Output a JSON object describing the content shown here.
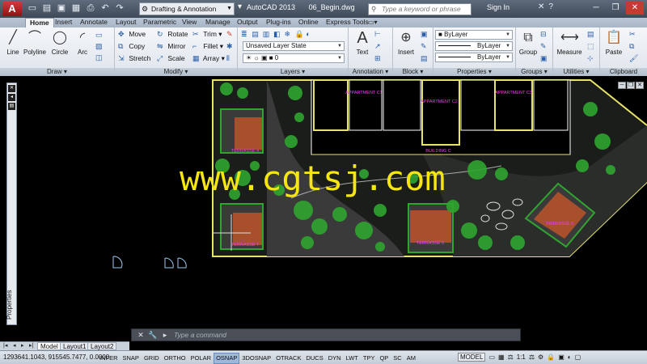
{
  "titlebar": {
    "app_name": "AutoCAD 2013",
    "file_name": "06_Begin.dwg",
    "workspace": "Drafting & Annotation",
    "search_placeholder": "Type a keyword or phrase",
    "sign_in": "Sign In"
  },
  "ribbon_tabs": [
    "Home",
    "Insert",
    "Annotate",
    "Layout",
    "Parametric",
    "View",
    "Manage",
    "Output",
    "Plug-ins",
    "Online",
    "Express Tools"
  ],
  "panels": {
    "draw": {
      "title": "Draw",
      "tools": [
        "Line",
        "Polyline",
        "Circle",
        "Arc"
      ]
    },
    "modify": {
      "title": "Modify",
      "tools": [
        "Move",
        "Rotate",
        "Trim",
        "Copy",
        "Mirror",
        "Fillet",
        "Stretch",
        "Scale",
        "Array"
      ]
    },
    "layers": {
      "title": "Layers",
      "layer_state": "Unsaved Layer State",
      "current_layer": "0"
    },
    "annotation": {
      "title": "Annotation",
      "text_label": "Text"
    },
    "block": {
      "title": "Block",
      "insert_label": "Insert"
    },
    "properties": {
      "title": "Properties",
      "color": "ByLayer",
      "linetype": "ByLayer",
      "lineweight": "ByLayer"
    },
    "groups": {
      "title": "Groups",
      "group_label": "Group"
    },
    "utilities": {
      "title": "Utilities",
      "measure_label": "Measure"
    },
    "clipboard": {
      "title": "Clipboard",
      "paste_label": "Paste"
    }
  },
  "palette_label": "Properties",
  "drawing_labels": {
    "apartment_c1": "APPARTMENT C1",
    "apartment_c2": "APPARTMENT C2",
    "apartment_c3": "APPARTMENT C3",
    "building_c": "BUILDING C",
    "terrasse_4": "TERRASSE 4",
    "terrasse_5": "TERRASSE 5",
    "terrasse_6": "TERRASSE 6",
    "terrasse_7": "TERRASSE 7"
  },
  "watermark": "www.cgtsj.com",
  "layout_tabs": [
    "Model",
    "Layout1",
    "Layout2"
  ],
  "command": {
    "placeholder": "Type a command"
  },
  "status": {
    "coordinates": "1293641.1043, 915545.7477, 0.0000",
    "toggles": [
      "INFER",
      "SNAP",
      "GRID",
      "ORTHO",
      "POLAR",
      "OSNAP",
      "3DOSNAP",
      "OTRACK",
      "DUCS",
      "DYN",
      "LWT",
      "TPY",
      "QP",
      "SC",
      "AM"
    ],
    "active_toggles": [
      "OSNAP"
    ],
    "space": "MODEL",
    "scale": "1:1"
  },
  "colors": {
    "landscape_border": "#e8e46a",
    "building_wall": "#ffffff",
    "label_magenta": "#f040f0",
    "watermark": "#f5e612",
    "vegetation": "#2fa52f",
    "deck": "#a8502c"
  }
}
